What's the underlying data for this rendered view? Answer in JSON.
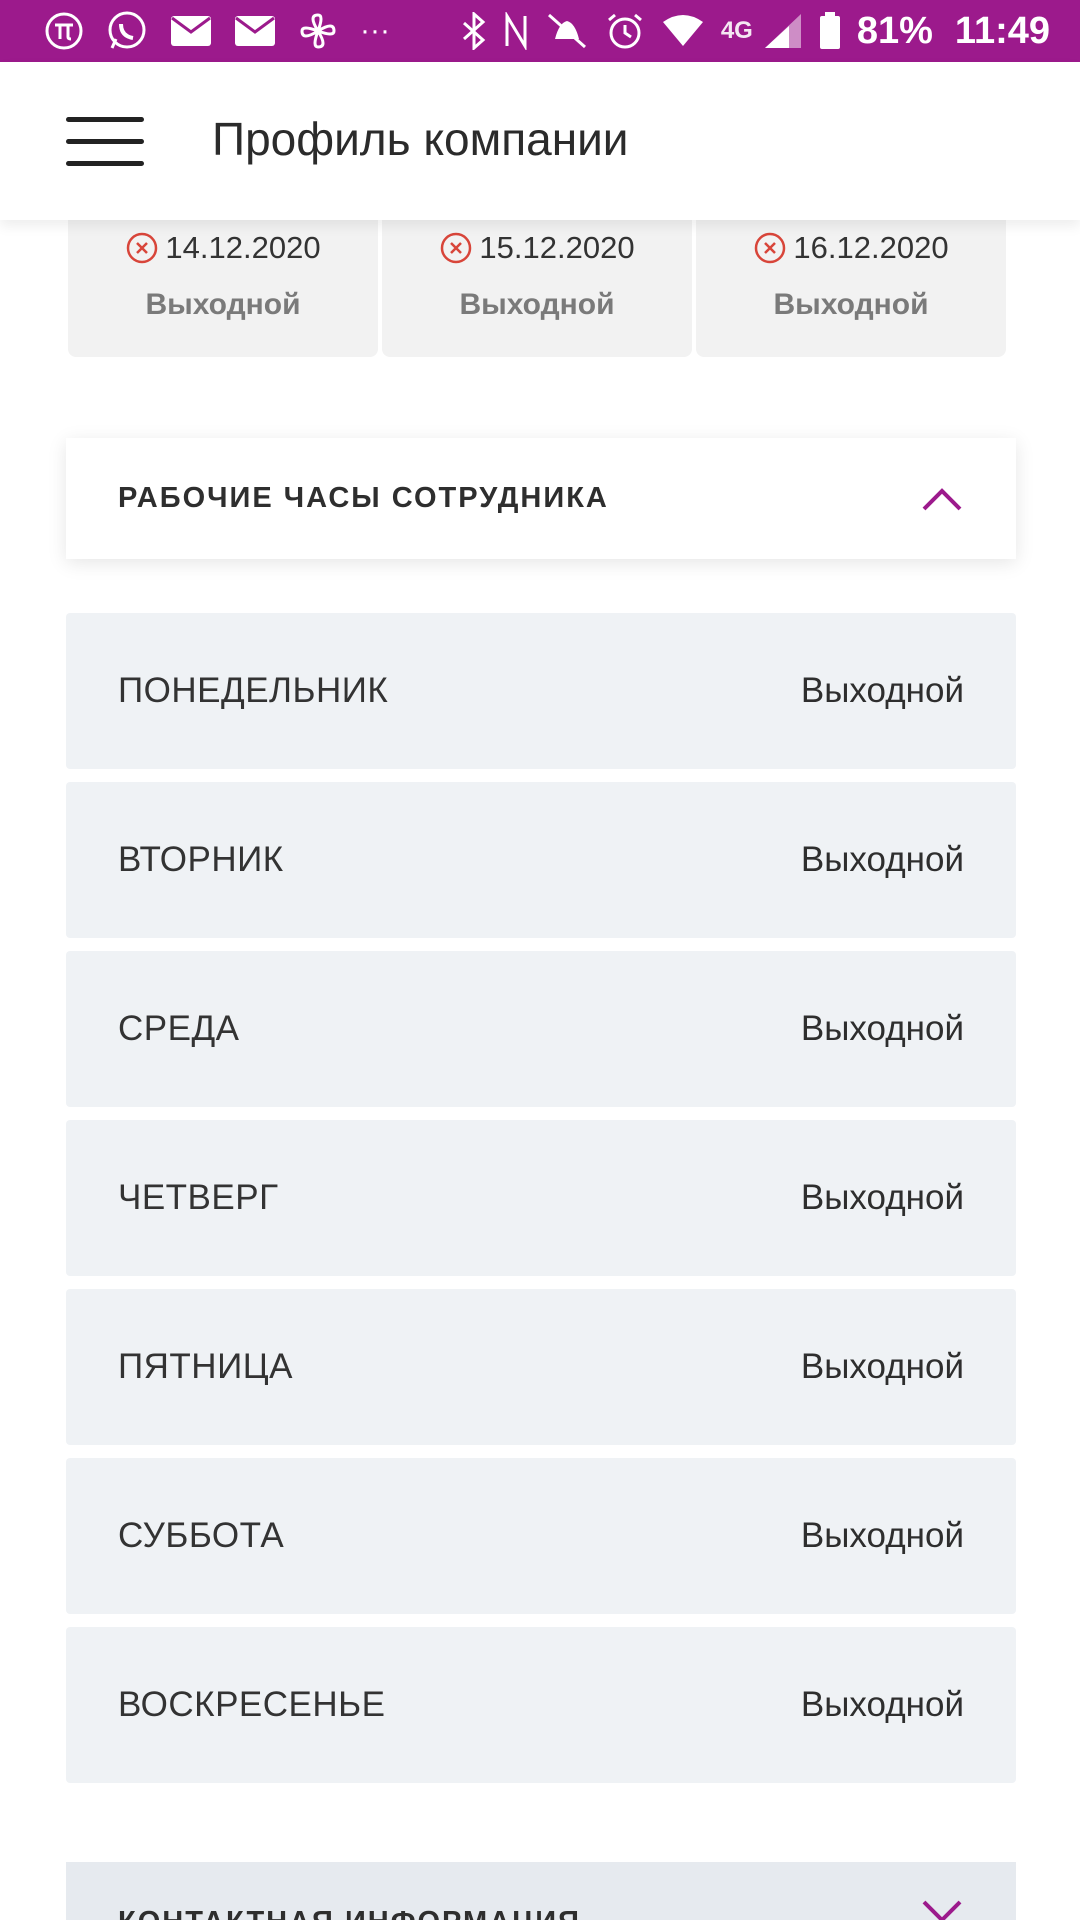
{
  "status_bar": {
    "battery_percent": "81%",
    "time": "11:49",
    "network": "4G",
    "icons": [
      "pi-icon",
      "whatsapp-icon",
      "mail-icon",
      "mail-icon",
      "pinwheel-icon",
      "more-icon",
      "bluetooth-icon",
      "nfc-icon",
      "mute-icon",
      "alarm-icon",
      "wifi-icon",
      "signal-icon",
      "battery-icon"
    ]
  },
  "header": {
    "title": "Профиль компании"
  },
  "exceptions": [
    {
      "date": "14.12.2020",
      "status": "Выходной"
    },
    {
      "date": "15.12.2020",
      "status": "Выходной"
    },
    {
      "date": "16.12.2020",
      "status": "Выходной"
    }
  ],
  "working_hours": {
    "title": "РАБОЧИЕ ЧАСЫ СОТРУДНИКА",
    "days": [
      {
        "day": "ПОНЕДЕЛЬНИК",
        "value": "Выходной"
      },
      {
        "day": "ВТОРНИК",
        "value": "Выходной"
      },
      {
        "day": "СРЕДА",
        "value": "Выходной"
      },
      {
        "day": "ЧЕТВЕРГ",
        "value": "Выходной"
      },
      {
        "day": "ПЯТНИЦА",
        "value": "Выходной"
      },
      {
        "day": "СУББОТА",
        "value": "Выходной"
      },
      {
        "day": "ВОСКРЕСЕНЬЕ",
        "value": "Выходной"
      }
    ]
  },
  "contact": {
    "title": "КОНТАКТНАЯ ИНФОРМАЦИЯ"
  },
  "colors": {
    "accent": "#9c1a8c",
    "error": "#d8453a",
    "row_bg": "#eff2f5"
  }
}
